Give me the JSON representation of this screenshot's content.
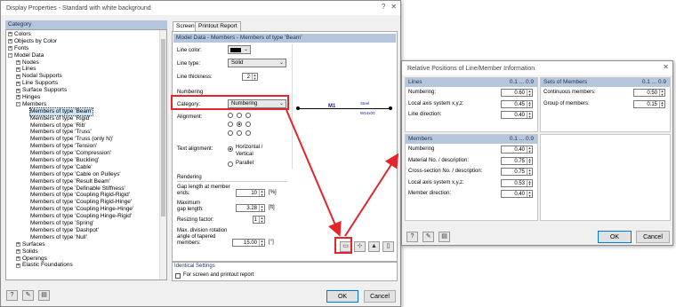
{
  "main_window": {
    "title": "Display Properties - Standard with white background",
    "category_header": "Category",
    "tree": [
      {
        "label": "Colors",
        "level": 0,
        "exp": "+"
      },
      {
        "label": "Objects by Color",
        "level": 0,
        "exp": "+"
      },
      {
        "label": "Fonts",
        "level": 0,
        "exp": "+"
      },
      {
        "label": "Model Data",
        "level": 0,
        "exp": "-"
      },
      {
        "label": "Nodes",
        "level": 1,
        "exp": "+"
      },
      {
        "label": "Lines",
        "level": 1,
        "exp": "+"
      },
      {
        "label": "Nodal Supports",
        "level": 1,
        "exp": "+"
      },
      {
        "label": "Line Supports",
        "level": 1,
        "exp": "+"
      },
      {
        "label": "Surface Supports",
        "level": 1,
        "exp": "+"
      },
      {
        "label": "Hinges",
        "level": 1,
        "exp": "+"
      },
      {
        "label": "Members",
        "level": 1,
        "exp": "-"
      },
      {
        "label": "Members of type 'Beam'",
        "level": 2,
        "exp": "",
        "selected": true
      },
      {
        "label": "Members of type 'Rigid'",
        "level": 2,
        "exp": ""
      },
      {
        "label": "Members of type 'Rib'",
        "level": 2,
        "exp": ""
      },
      {
        "label": "Members of type 'Truss'",
        "level": 2,
        "exp": ""
      },
      {
        "label": "Members of type 'Truss (only N)'",
        "level": 2,
        "exp": ""
      },
      {
        "label": "Members of type 'Tension'",
        "level": 2,
        "exp": ""
      },
      {
        "label": "Members of type 'Compression'",
        "level": 2,
        "exp": ""
      },
      {
        "label": "Members of type 'Buckling'",
        "level": 2,
        "exp": ""
      },
      {
        "label": "Members of type 'Cable'",
        "level": 2,
        "exp": ""
      },
      {
        "label": "Members of type 'Cable on Pulleys'",
        "level": 2,
        "exp": ""
      },
      {
        "label": "Members of type 'Result Beam'",
        "level": 2,
        "exp": ""
      },
      {
        "label": "Members of type 'Definable Stiffness'",
        "level": 2,
        "exp": ""
      },
      {
        "label": "Members of type 'Coupling Rigid-Rigid'",
        "level": 2,
        "exp": ""
      },
      {
        "label": "Members of type 'Coupling Rigid-Hinge'",
        "level": 2,
        "exp": ""
      },
      {
        "label": "Members of type 'Coupling Hinge-Hinge'",
        "level": 2,
        "exp": ""
      },
      {
        "label": "Members of type 'Coupling Hinge-Rigid'",
        "level": 2,
        "exp": ""
      },
      {
        "label": "Members of type 'Spring'",
        "level": 2,
        "exp": ""
      },
      {
        "label": "Members of type 'Dashpot'",
        "level": 2,
        "exp": ""
      },
      {
        "label": "Members of type 'Null'",
        "level": 2,
        "exp": ""
      },
      {
        "label": "Surfaces",
        "level": 1,
        "exp": "+"
      },
      {
        "label": "Solids",
        "level": 1,
        "exp": "+"
      },
      {
        "label": "Openings",
        "level": 1,
        "exp": "+"
      },
      {
        "label": "Elastic Foundations",
        "level": 1,
        "exp": "+"
      }
    ],
    "tabs": [
      "Screen",
      "Printout Report"
    ],
    "model_header": "Model Data - Members - Members of type 'Beam'",
    "line_color_label": "Line color:",
    "line_type_label": "Line type:",
    "line_type_value": "Solid",
    "line_thickness_label": "Line thickness:",
    "line_thickness_value": "2",
    "numbering_header": "Numbering",
    "category_label": "Category:",
    "category_value": "Numbering",
    "alignment_label": "Alignment:",
    "text_alignment_label": "Text alignment:",
    "horizontal_label": "Horizontal /",
    "vertical_label": "Vertical",
    "parallel_label": "Parallel",
    "rendering_header": "Rendering",
    "gap_label_1": "Gap length at member",
    "gap_label_2": "ends:",
    "gap_value": "10",
    "gap_unit": "[%]",
    "max_gap_label_1": "Maximum",
    "max_gap_label_2": "gap length:",
    "max_gap_value": "3.28",
    "max_gap_unit": "[ft]",
    "resizing_label": "Resizing factor:",
    "resizing_value": "1",
    "rotation_label_1": "Max. division rotation",
    "rotation_label_2": "angle of tapered",
    "rotation_label_3": "members:",
    "rotation_value": "15.00",
    "rotation_unit": "[°]",
    "preview_label": "M1",
    "preview_annot_1": "Steel",
    "preview_annot_2": "W14x00",
    "identical_header": "Identical Settings",
    "identical_label": "For screen and printout report",
    "ok": "OK",
    "cancel": "Cancel"
  },
  "dialog": {
    "title": "Relative Positions of Line/Member Information",
    "lines_header": "Lines",
    "lines_range": "0.1 ... 0.9",
    "lines_rows": [
      {
        "label": "Numbering:",
        "value": "0.60"
      },
      {
        "label": "Local axis system x,y,z:",
        "value": "0.45"
      },
      {
        "label": "Line direction:",
        "value": "0.40"
      }
    ],
    "sets_header": "Sets of Members",
    "sets_range": "0.1 ... 0.9",
    "sets_rows": [
      {
        "label": "Continuous members:",
        "value": "0.50"
      },
      {
        "label": "Group of members:",
        "value": "0.15"
      }
    ],
    "members_header": "Members",
    "members_range": "0.1 ... 0.9",
    "members_rows": [
      {
        "label": "Numbering",
        "value": "0.40"
      },
      {
        "label": "Material No. / description:",
        "value": "0.75"
      },
      {
        "label": "Cross-section No. / description:",
        "value": "0.75"
      },
      {
        "label": "Local axis system x,y,z:",
        "value": "0.53"
      },
      {
        "label": "Member direction:",
        "value": "0.40"
      }
    ],
    "ok": "OK",
    "cancel": "Cancel"
  },
  "colors": {
    "accent_red": "#e2262c",
    "header_blue": "#b5c6dc"
  }
}
